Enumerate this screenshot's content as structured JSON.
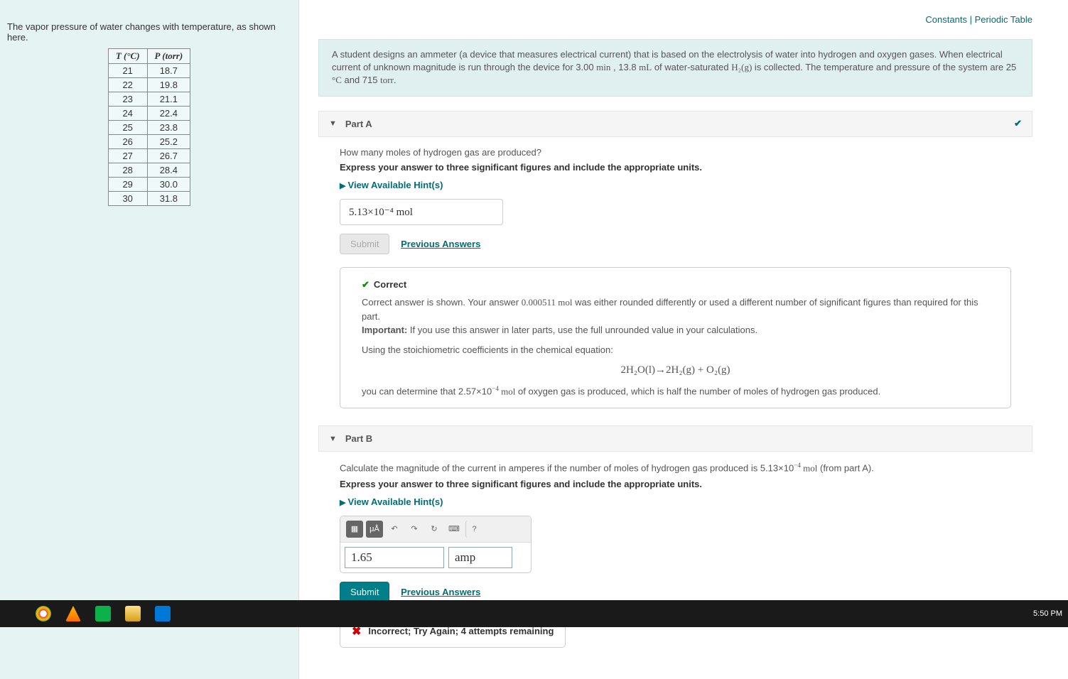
{
  "top_links": {
    "constants": "Constants",
    "sep": " | ",
    "periodic": "Periodic Table"
  },
  "left_intro": "The vapor pressure of water changes with temperature, as shown here.",
  "table": {
    "head_t": "T (°C)",
    "head_p": "P (torr)",
    "rows": [
      {
        "t": "21",
        "p": "18.7"
      },
      {
        "t": "22",
        "p": "19.8"
      },
      {
        "t": "23",
        "p": "21.1"
      },
      {
        "t": "24",
        "p": "22.4"
      },
      {
        "t": "25",
        "p": "23.8"
      },
      {
        "t": "26",
        "p": "25.2"
      },
      {
        "t": "27",
        "p": "26.7"
      },
      {
        "t": "28",
        "p": "28.4"
      },
      {
        "t": "29",
        "p": "30.0"
      },
      {
        "t": "30",
        "p": "31.8"
      }
    ]
  },
  "problem": {
    "t1": "A student designs an ammeter (a device that measures electrical current) that is based on the electrolysis of water into hydrogen and oxygen gases. When electrical current of unknown magnitude is run through the device for 3.00 ",
    "v1": "min",
    "t2": " , 13.8 ",
    "v2": "mL",
    "t3": " of water-saturated ",
    "h2g": "H₂(g)",
    "t4": " is collected. The temperature and pressure of the system are 25 ",
    "degc": "°C",
    "t5": " and 715 ",
    "torr": "torr",
    "t6": "."
  },
  "partA": {
    "title": "Part A",
    "q": "How many moles of hydrogen gas are produced?",
    "inst": "Express your answer to three significant figures and include the appropriate units.",
    "hints": "View Available Hint(s)",
    "answer": "5.13×10⁻⁴ mol",
    "submit": "Submit",
    "prev": "Previous Answers",
    "fb_head": "Correct",
    "fb1a": "Correct answer is shown. Your answer ",
    "fb1b": "0.000511 mol",
    "fb1c": " was either rounded differently or used a different number of significant figures than required for this part.",
    "fb2a": "Important:",
    "fb2b": " If you use this answer in later parts, use the full unrounded value in your calculations.",
    "fb3": "Using the stoichiometric coefficients in the chemical equation:",
    "eq": "2H₂O(l)→2H₂(g) + O₂(g)",
    "fb4a": "you can determine that 2.57×10",
    "fb4exp": "−4",
    "fb4b": " mol",
    "fb4c": " of oxygen gas is produced, which is half the number of moles of hydrogen gas produced."
  },
  "partB": {
    "title": "Part B",
    "q1": "Calculate the magnitude of the current in amperes if the number of moles of hydrogen gas produced is 5.13×10",
    "q_exp": "−4",
    "q2": " mol",
    "q3": " (from part A).",
    "inst": "Express your answer to three significant figures and include the appropriate units.",
    "hints": "View Available Hint(s)",
    "tb_mu": "μÅ",
    "val": "1.65",
    "unit": "amp",
    "submit": "Submit",
    "prev": "Previous Answers",
    "incorrect": "Incorrect; Try Again; 4 attempts remaining"
  },
  "clock": "5:50 PM"
}
